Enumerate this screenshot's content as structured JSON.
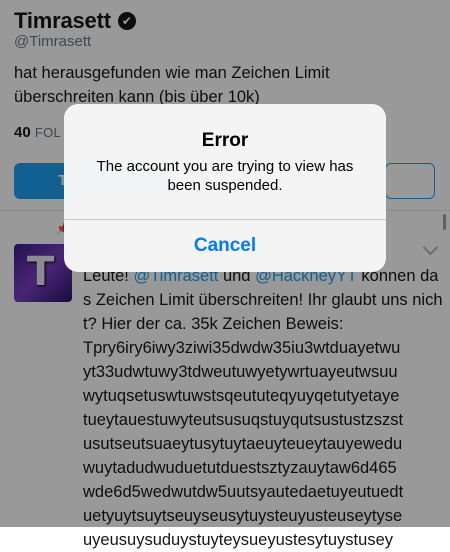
{
  "profile": {
    "name": "Timrasett",
    "verified_icon": "check",
    "handle": "@Timrasett",
    "bio": "hat herausgefunden wie man Zeichen Limit überschreiten kann (bis über 10k)",
    "followers_count": "40",
    "followers_label": "FOL"
  },
  "tweet": {
    "text_lines": [
      "Tpry6iry6iwy3ziwi35dwdw35iu3wtduayetwu",
      "yt33udwtuwy3tdweutuwyetywrtuayeutwsuu",
      "wytuqsetuswtuwstsqeututeqyuyqetutyetaye",
      "tueytauestuwyteutsusuqstuyqutsustustzszst",
      "usutseutsuaeytusytuytaeuyteueytauyewedu",
      "wuytadudwuduetutduestsztyzauytaw6d465",
      "wde6d5wedwutdw5uutsyautedaetuyeutuedt",
      "uetyuytsuytseuyseusytuysteuyusteuseytyse",
      "uyeusuysuduystuyteysueyustesytuystusey"
    ],
    "intro_prefix": "Leute! ",
    "mention1": "@Timrasett",
    "mid": " und ",
    "mention2": "@HackneyYT",
    "after": " können das Zeichen Limit überschreiten! Ihr glaubt uns nicht? Hier der ca. 35k Zeichen Beweis:",
    "avatar_letter": "T"
  },
  "alert": {
    "title": "Error",
    "message": "The account you are trying to view has been suspended.",
    "cancel_label": "Cancel"
  }
}
